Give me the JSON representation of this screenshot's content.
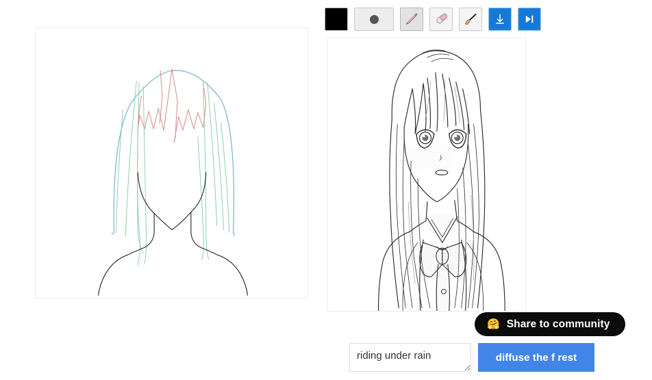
{
  "toolbar": {
    "items": [
      {
        "name": "color-swatch",
        "label": "",
        "icon": "color-swatch-icon",
        "color": "#000000",
        "selected": false
      },
      {
        "name": "brush-size",
        "label": "",
        "icon": "brush-size-dot-icon",
        "selected": false
      },
      {
        "name": "pencil-tool",
        "label": "",
        "icon": "pencil-icon",
        "selected": true
      },
      {
        "name": "eraser-tool",
        "label": "",
        "icon": "eraser-icon",
        "selected": false
      },
      {
        "name": "brush-tool",
        "label": "",
        "icon": "paintbrush-icon",
        "selected": false
      },
      {
        "name": "download",
        "label": "",
        "icon": "download-arrow-down-icon",
        "selected": false
      },
      {
        "name": "next",
        "label": "",
        "icon": "skip-forward-icon",
        "selected": false
      }
    ]
  },
  "share": {
    "emoji": "🤗",
    "label": "Share to community"
  },
  "prompt": {
    "value": "riding under rain",
    "placeholder": "",
    "submit_label": "diffuse the f rest"
  },
  "colors": {
    "accent_blue": "#4285e8",
    "toolbar_blue": "#1479d8",
    "share_black": "#0b0b0b",
    "sketch_outline_blue": "#7fb8d4",
    "sketch_hair_green": "#8ecfae",
    "sketch_bangs_red": "#d98a8a",
    "sketch_face_black": "#222222"
  },
  "sketch_canvas": {
    "name": "input-sketch-canvas",
    "description": "line-art sketch of an anime girl head and shoulders with long hair"
  },
  "result_image": {
    "name": "generated-result-image",
    "description": "monochrome manga-style drawing of a blushing anime schoolgirl with long hair and a bow tie"
  }
}
